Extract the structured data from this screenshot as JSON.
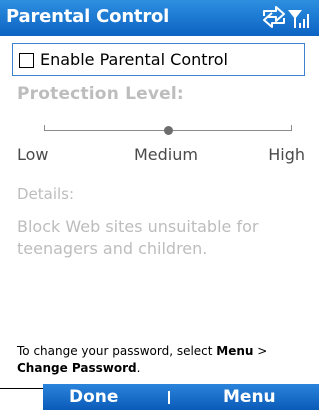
{
  "window": {
    "title": "Parental Control",
    "status_icons": [
      "connection-icon",
      "signal-strength-icon"
    ]
  },
  "settings": {
    "enable_label": "Enable Parental Control",
    "enabled": false,
    "protection_label": "Protection Level:",
    "levels": {
      "low": "Low",
      "medium": "Medium",
      "high": "High"
    },
    "selected_level": "Medium",
    "slider_fraction": 0.5,
    "details_label": "Details:",
    "details_text": "Block Web sites unsuitable for teenagers and children."
  },
  "note": {
    "prefix": "To change your password, select ",
    "menu_word": "Menu",
    "separator": " > ",
    "action": "Change Password",
    "suffix": "."
  },
  "softkeys": {
    "left": "Done",
    "right": "Menu"
  },
  "colors": {
    "title_bar": "#0d63c3",
    "softkey_bar": "#0a5bb8",
    "disabled_text": "#bdbdbd",
    "focus_border": "#3f82cc"
  }
}
